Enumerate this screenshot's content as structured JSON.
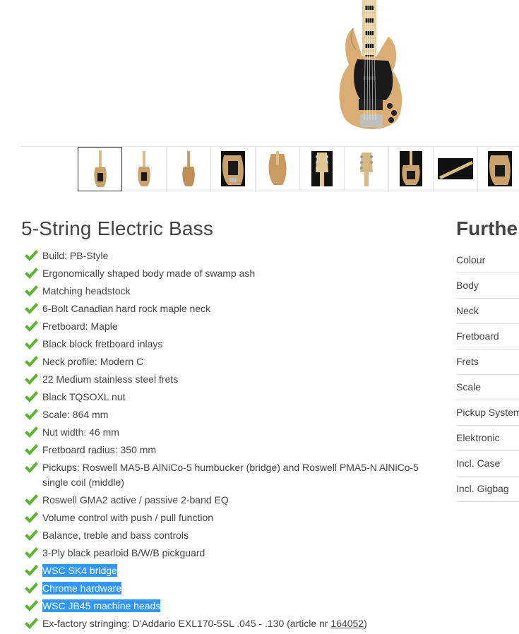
{
  "product": {
    "title": "5-String Electric Bass"
  },
  "thumbnails": [
    {
      "name": "full-front"
    },
    {
      "name": "front-standing"
    },
    {
      "name": "back"
    },
    {
      "name": "body-closeup"
    },
    {
      "name": "body-back"
    },
    {
      "name": "headstock-front"
    },
    {
      "name": "headstock-back"
    },
    {
      "name": "body-dark"
    },
    {
      "name": "neck-side"
    },
    {
      "name": "body-angle"
    }
  ],
  "features": [
    {
      "text": "Build: PB-Style"
    },
    {
      "text": "Ergonomically shaped body made of swamp ash"
    },
    {
      "text": "Matching headstock"
    },
    {
      "text": "6-Bolt Canadian hard rock maple neck"
    },
    {
      "text": "Fretboard: Maple"
    },
    {
      "text": "Black block fretboard inlays"
    },
    {
      "text": "Neck profile: Modern C"
    },
    {
      "text": "22 Medium stainless steel frets"
    },
    {
      "text": "Black TQSOXL nut"
    },
    {
      "text": "Scale: 864 mm"
    },
    {
      "text": "Nut width: 46 mm"
    },
    {
      "text": "Fretboard radius: 350 mm"
    },
    {
      "text": "Pickups: Roswell MA5-B AlNiCo-5 humbucker (bridge) and Roswell PMA5-N AlNiCo-5 single coil (middle)"
    },
    {
      "text": "Roswell GMA2 active / passive 2-band EQ"
    },
    {
      "text": "Volume control with push / pull function"
    },
    {
      "text": "Balance, treble and bass controls"
    },
    {
      "text": "3-Ply black pearloid B/W/B pickguard"
    },
    {
      "text": "WSC SK4 bridge"
    },
    {
      "text": "Chrome hardware"
    },
    {
      "text": "WSC JB45 machine heads"
    }
  ],
  "last_feature": {
    "prefix": "Ex-factory stringing: D'Addario EXL170-5SL .045 - .130 (article nr ",
    "link": "164052",
    "suffix": ")"
  },
  "further": {
    "title": "Further",
    "rows": [
      "Colour",
      "Body",
      "Neck",
      "Fretboard",
      "Frets",
      "Scale",
      "Pickup System",
      "Elektronic",
      "Incl. Case",
      "Incl. Gigbag"
    ]
  },
  "colors": {
    "check": "#5cb531",
    "highlight": "#3297fd",
    "text": "#444444",
    "border": "#e3e3e3"
  }
}
